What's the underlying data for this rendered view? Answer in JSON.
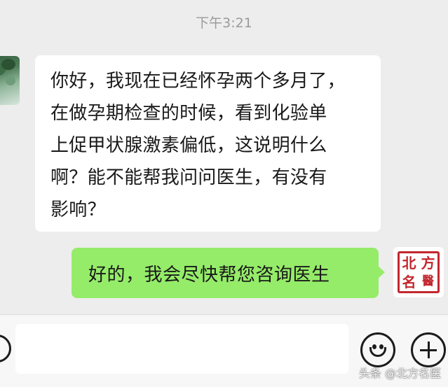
{
  "chat": {
    "timestamp": "下午3:21",
    "messages": [
      {
        "side": "left",
        "text": "你好，我现在已经怀孕两个多月了，\n在做孕期检查的时候，看到化验单\n上促甲状腺激素偏低，这说明什么\n啊？能不能帮我问问医生，有没有\n影响？"
      },
      {
        "side": "right",
        "text": "好的，我会尽快帮您咨询医生"
      }
    ],
    "sender_avatar_seal": [
      "北",
      "方",
      "名",
      "醫"
    ]
  },
  "input_bar": {
    "value": "",
    "emoji_icon": "smiley-icon",
    "more_icon": "plus-circle-icon"
  },
  "watermark": "头条 @北方名医",
  "colors": {
    "background": "#ededed",
    "incoming_bubble": "#ffffff",
    "outgoing_bubble": "#95ec69",
    "seal_red": "#c2272d"
  }
}
